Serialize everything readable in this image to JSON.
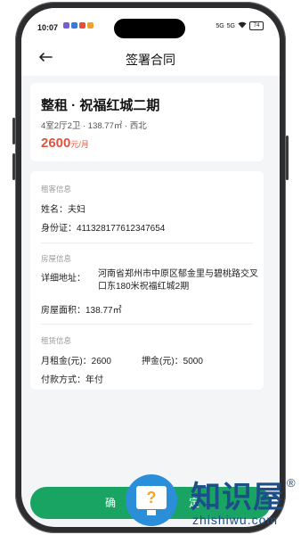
{
  "status_bar": {
    "time": "10:07",
    "signal_1": "5G",
    "signal_2": "5G",
    "battery": "74"
  },
  "nav": {
    "title": "签署合同",
    "back_icon": "arrow-left-icon"
  },
  "house": {
    "title": "整租 · 祝福红城二期",
    "meta": "4室2厅2卫 · 138.77㎡ · 西北",
    "price": "2600",
    "price_unit": "元/月"
  },
  "tenant_info": {
    "section_label": "租客信息",
    "name_label": "姓名：",
    "name_value": "夫妇",
    "id_label": "身份证：",
    "id_value": "411328177612347654"
  },
  "house_info": {
    "section_label": "房屋信息",
    "address_label": "详细地址：",
    "address_value": "河南省郑州市中原区郁金里与碧桃路交叉口东180米祝福红城2期",
    "area_label": "房屋面积：",
    "area_value": "138.77㎡"
  },
  "rent_info": {
    "section_label": "租赁信息",
    "monthly_rent_label": "月租金(元)：",
    "monthly_rent_value": "2600",
    "deposit_label": "押金(元)：",
    "deposit_value": "5000",
    "payment_label": "付款方式：",
    "payment_value": "年付"
  },
  "confirm_button": {
    "label_left": "确",
    "label_right": "定"
  },
  "watermark": {
    "title": "知识屋",
    "reg": "®",
    "subtitle": "zhishiwu.com"
  },
  "colors": {
    "accent_green": "#1aa463",
    "price_red": "#e2543c"
  }
}
